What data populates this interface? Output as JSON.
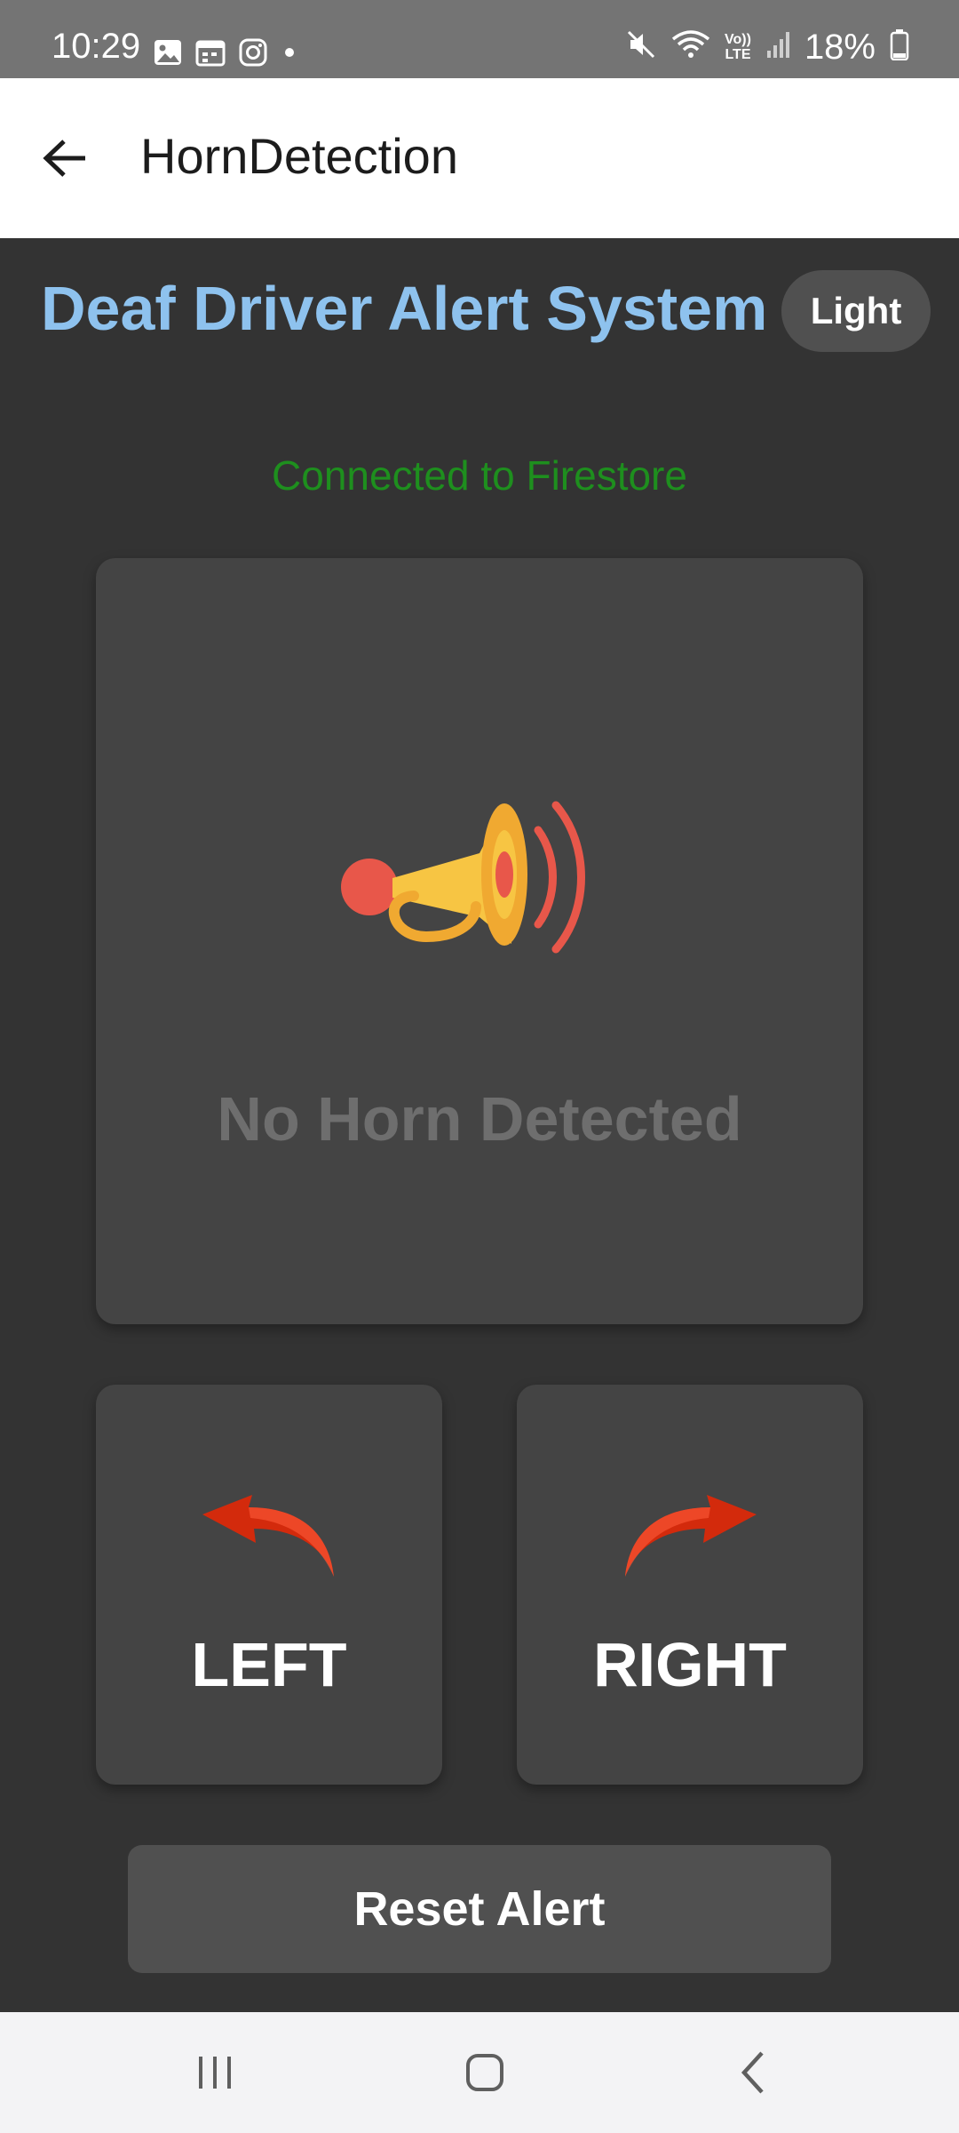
{
  "status_bar": {
    "time": "10:29",
    "battery": "18%",
    "left_icons": [
      "gallery-icon",
      "calendar-icon",
      "instagram-icon",
      "notification-dot-icon"
    ],
    "right_icons": [
      "mute-icon",
      "wifi-icon",
      "volte-icon",
      "signal-icon",
      "battery-icon"
    ],
    "volte_top": "Vo))",
    "volte_bottom": "LTE"
  },
  "app_bar": {
    "title": "HornDetection",
    "back_icon": "arrow-left-icon"
  },
  "main": {
    "heading": "Deaf Driver Alert System",
    "theme_toggle_label": "Light",
    "connection_status": "Connected to Firestore",
    "horn_icon": "horn-icon",
    "horn_status": "No Horn Detected",
    "left_label": "LEFT",
    "right_label": "RIGHT",
    "reset_label": "Reset Alert"
  },
  "colors": {
    "background": "#333333",
    "card": "#444444",
    "heading": "#8ec2ee",
    "connected": "#1e8f1e",
    "arrow": "#d32a0c",
    "horn_body": "#f7c543",
    "horn_accent": "#e8574a"
  },
  "nav_bar": {
    "icons": [
      "recents-icon",
      "home-icon",
      "back-icon"
    ]
  }
}
